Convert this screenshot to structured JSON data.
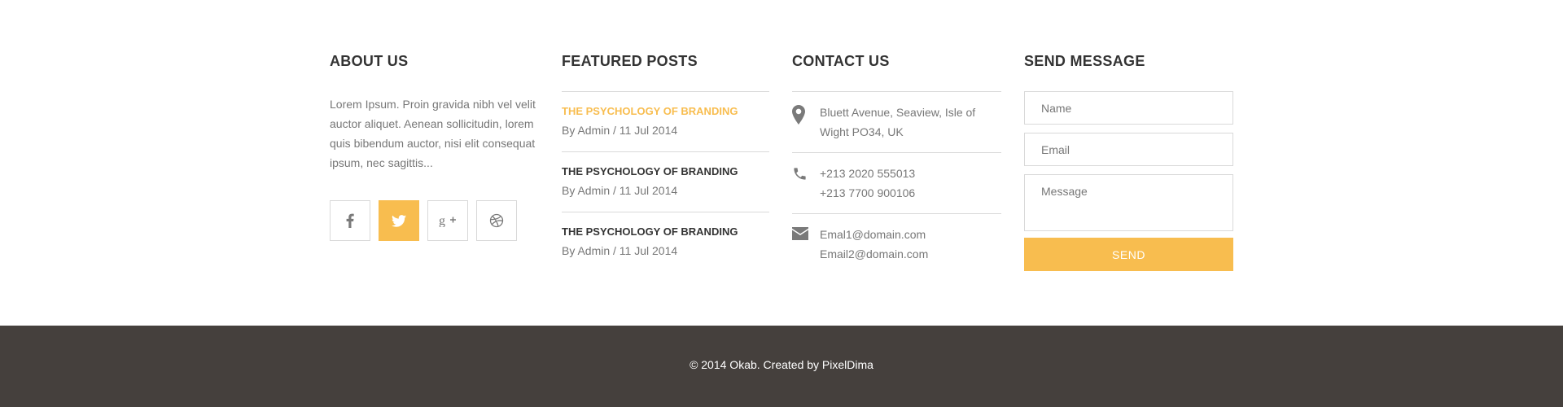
{
  "about": {
    "title": "ABOUT US",
    "text": "Lorem Ipsum. Proin gravida nibh vel velit auctor aliquet. Aenean sollicitudin, lorem quis bibendum auctor, nisi elit consequat ipsum, nec sagittis...",
    "social": [
      {
        "name": "facebook-icon",
        "active": false
      },
      {
        "name": "twitter-icon",
        "active": true
      },
      {
        "name": "google-plus-icon",
        "active": false
      },
      {
        "name": "dribbble-icon",
        "active": false
      }
    ]
  },
  "featured": {
    "title": "FEATURED POSTS",
    "posts": [
      {
        "title": "THE PSYCHOLOGY OF BRANDING",
        "meta": "By Admin / 11 Jul 2014",
        "highlight": true
      },
      {
        "title": "THE PSYCHOLOGY OF BRANDING",
        "meta": "By Admin / 11 Jul 2014",
        "highlight": false
      },
      {
        "title": "THE PSYCHOLOGY OF BRANDING",
        "meta": "By Admin / 11 Jul 2014",
        "highlight": false
      }
    ]
  },
  "contact": {
    "title": "CONTACT US",
    "address": [
      "Bluett Avenue, Seaview, Isle of",
      "Wight PO34, UK"
    ],
    "phones": [
      "+213 2020 555013",
      "+213 7700 900106"
    ],
    "emails": [
      "Emal1@domain.com",
      "Email2@domain.com"
    ],
    "icons": [
      "map-marker-icon",
      "phone-icon",
      "envelope-icon"
    ]
  },
  "send": {
    "title": "SEND MESSAGE",
    "name_placeholder": "Name",
    "email_placeholder": "Email",
    "message_placeholder": "Message",
    "button": "SEND"
  },
  "footer": {
    "copyright": "© 2014 Okab. Created by PixelDima"
  },
  "colors": {
    "accent": "#f8bd4f",
    "bottom_bar": "#45403d",
    "text_muted": "#777777",
    "heading": "#333333"
  }
}
